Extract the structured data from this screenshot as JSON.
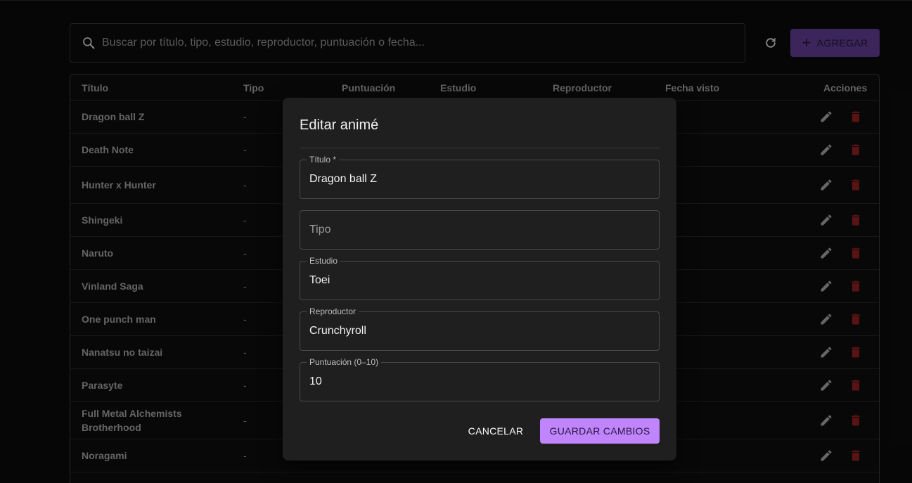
{
  "search": {
    "placeholder": "Buscar por título, tipo, estudio, reproductor, puntuación o fecha..."
  },
  "toolbar": {
    "add_label": "AGREGAR",
    "refresh_icon": "refresh-icon",
    "plus_icon": "plus-icon"
  },
  "table": {
    "headers": {
      "titulo": "Título",
      "tipo": "Tipo",
      "puntuacion": "Puntuación",
      "estudio": "Estudio",
      "reproductor": "Reproductor",
      "fecha": "Fecha visto",
      "acciones": "Acciones"
    },
    "rows": [
      {
        "titulo": "Dragon ball Z",
        "tipo": "-"
      },
      {
        "titulo": "Death Note",
        "tipo": "-"
      },
      {
        "titulo": "Hunter x Hunter",
        "tipo": "-"
      },
      {
        "titulo": "Shingeki",
        "tipo": "-"
      },
      {
        "titulo": "Naruto",
        "tipo": "-"
      },
      {
        "titulo": "Vinland Saga",
        "tipo": "-"
      },
      {
        "titulo": "One punch man",
        "tipo": "-"
      },
      {
        "titulo": "Nanatsu no taizai",
        "tipo": "-"
      },
      {
        "titulo": "Parasyte",
        "tipo": "-"
      },
      {
        "titulo": "Full Metal Alchemists Brotherhood",
        "tipo": "-"
      },
      {
        "titulo": "Noragami",
        "tipo": "-"
      }
    ],
    "icons": {
      "edit": "pencil-icon",
      "delete": "trash-icon"
    }
  },
  "dialog": {
    "title": "Editar animé",
    "fields": {
      "titulo": {
        "label": "Título *",
        "value": "Dragon ball Z"
      },
      "tipo": {
        "placeholder": "Tipo",
        "value": ""
      },
      "estudio": {
        "label": "Estudio",
        "value": "Toei"
      },
      "reproductor": {
        "label": "Reproductor",
        "value": "Crunchyroll"
      },
      "puntuacion": {
        "label": "Puntuación (0–10)",
        "value": "10"
      }
    },
    "cancel_label": "CANCELAR",
    "save_label": "GUARDAR CAMBIOS"
  },
  "colors": {
    "accent": "#c084fc",
    "accent_dim": "#5b3a8a",
    "delete": "#8b1e1e",
    "background": "#0a0a0a",
    "dialog_bg": "#1f1f1f"
  }
}
